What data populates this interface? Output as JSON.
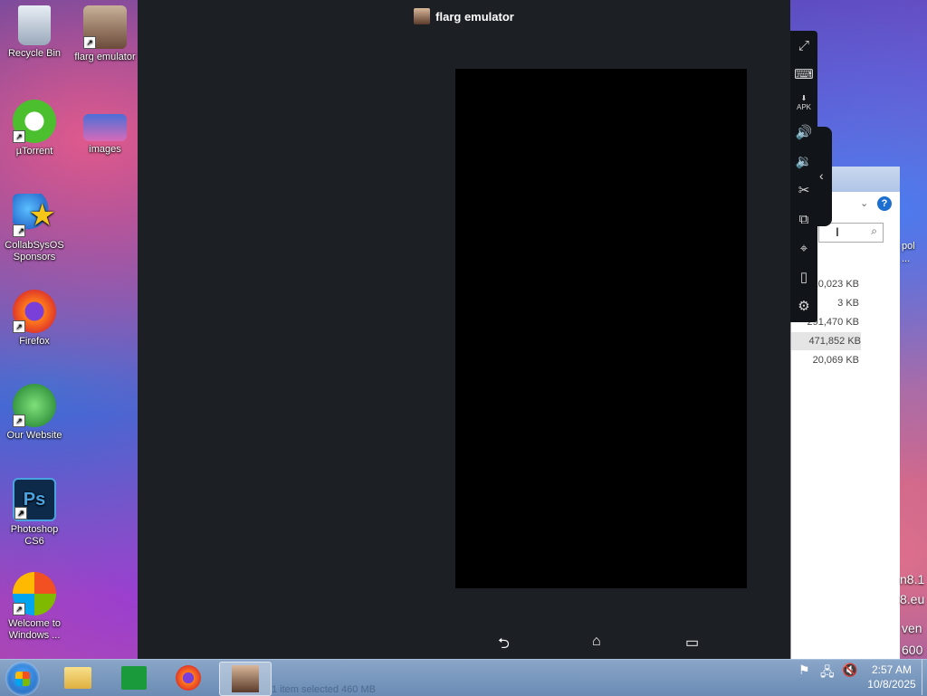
{
  "desktop": {
    "icons": [
      {
        "label": "Recycle Bin"
      },
      {
        "label": "flarg emulator"
      },
      {
        "label": "µTorrent"
      },
      {
        "label": "images"
      },
      {
        "label": "CollabSysOS Sponsors"
      },
      {
        "label": "Firefox"
      },
      {
        "label": "Our Website"
      },
      {
        "label": "Photoshop CS6"
      },
      {
        "label": "Welcome to Windows ..."
      }
    ],
    "right_edge_text": [
      "pol",
      "...",
      "n8.1",
      "8.eu",
      "ven",
      "600"
    ]
  },
  "emulator": {
    "title": "flarg emulator",
    "nav": {
      "back": "⮌",
      "home": "⌂",
      "recents": "▭"
    },
    "toolbar_icons": [
      "fullscreen-icon",
      "keyboard-icon",
      "apk-install-icon",
      "volume-up-icon",
      "volume-down-icon",
      "screenshot-scissors-icon",
      "add-window-icon",
      "location-icon",
      "shake-icon",
      "settings-icon"
    ],
    "apk_label": "APK"
  },
  "explorer": {
    "help": "?",
    "sizes": [
      "20,023 KB",
      "3 KB",
      "291,470 KB",
      "471,852 KB",
      "20,069 KB"
    ],
    "selected_index": 3,
    "status_text": "1 item selected  460 MB"
  },
  "taskbar": {
    "time": "2:57 AM",
    "date": "10/8/2025",
    "apps": [
      "file-explorer",
      "store",
      "firefox",
      "flarg-emulator"
    ]
  }
}
